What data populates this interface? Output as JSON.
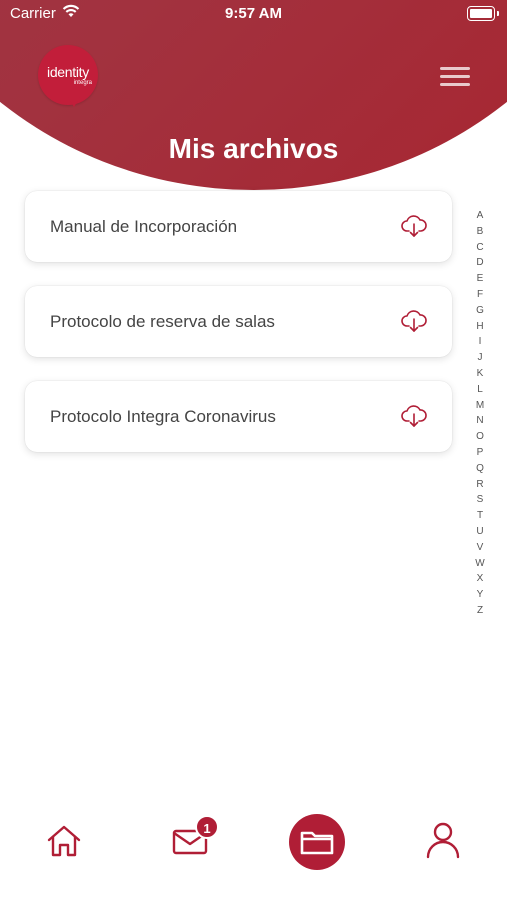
{
  "status_bar": {
    "carrier": "Carrier",
    "time": "9:57 AM"
  },
  "header": {
    "logo": {
      "title": "identity",
      "subtitle": "integra"
    },
    "title": "Mis archivos",
    "menu_icon": "hamburger-icon"
  },
  "files": [
    {
      "name": "Manual de Incorporación",
      "icon": "cloud-download-icon"
    },
    {
      "name": "Protocolo de reserva de salas",
      "icon": "cloud-download-icon"
    },
    {
      "name": "Protocolo Integra Coronavirus",
      "icon": "cloud-download-icon"
    }
  ],
  "alphabet_index": [
    "A",
    "B",
    "C",
    "D",
    "E",
    "F",
    "G",
    "H",
    "I",
    "J",
    "K",
    "L",
    "M",
    "N",
    "O",
    "P",
    "Q",
    "R",
    "S",
    "T",
    "U",
    "V",
    "W",
    "X",
    "Y",
    "Z"
  ],
  "tab_bar": {
    "tabs": [
      {
        "name": "home",
        "icon": "home-icon",
        "active": false
      },
      {
        "name": "messages",
        "icon": "mail-icon",
        "active": false,
        "badge": "1"
      },
      {
        "name": "files",
        "icon": "folder-icon",
        "active": true
      },
      {
        "name": "profile",
        "icon": "user-icon",
        "active": false
      }
    ]
  },
  "colors": {
    "brand": "#b01e36",
    "header_gradient_start": "#9a3a4a",
    "header_gradient_end": "#a8242f",
    "card_background": "#ffffff"
  }
}
